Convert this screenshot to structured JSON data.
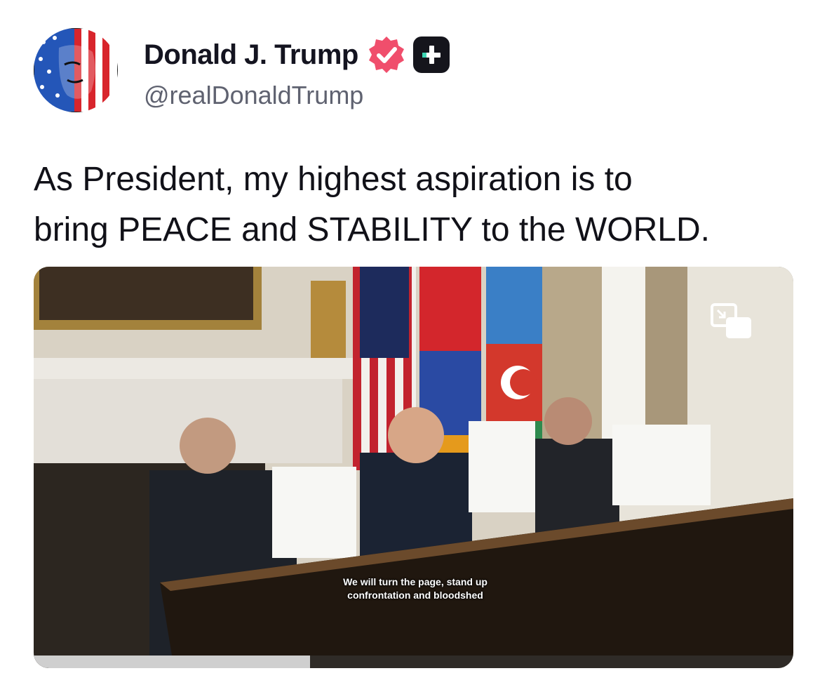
{
  "author": {
    "display_name": "Donald J. Trump",
    "handle": "@realDonaldTrump",
    "avatar_icon": "flag-face-avatar",
    "verified_icon": "verified-badge-icon",
    "verified_color": "#f04e6c",
    "plus_badge_icon": "plus-badge-icon"
  },
  "post": {
    "text_line1": "As President, my highest aspiration is to",
    "text_line2": "bring PEACE and STABILITY to the WORLD."
  },
  "media": {
    "type": "video",
    "caption_line1": "We will turn the page, stand up",
    "caption_line2": "confrontation and bloodshed",
    "pip_icon": "picture-in-picture-icon",
    "progress": 0.364
  }
}
